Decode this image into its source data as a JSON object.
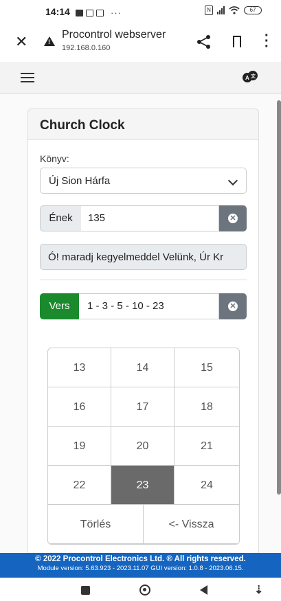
{
  "status_bar": {
    "time": "14:14",
    "dots": "···",
    "battery": "67",
    "nfc": "N"
  },
  "browser": {
    "title": "Procontrol webserver",
    "url": "192.168.0.160"
  },
  "card": {
    "title": "Church Clock"
  },
  "book": {
    "label": "Könyv:",
    "selected": "Új Sion Hárfa"
  },
  "song": {
    "addon_label": "Ének",
    "number": "135",
    "title": "Ó! maradj kegyelmeddel Velünk, Úr Kr"
  },
  "verse": {
    "addon_label": "Vers",
    "value": "1 - 3 - 5 - 10 - 23",
    "accent": "#1a8a2c"
  },
  "keypad": {
    "rows": [
      [
        "13",
        "14",
        "15"
      ],
      [
        "16",
        "17",
        "18"
      ],
      [
        "19",
        "20",
        "21"
      ],
      [
        "22",
        "23",
        "24"
      ]
    ],
    "selected": "23",
    "clear_label": "Törlés",
    "back_label": "<- Vissza"
  },
  "footer": {
    "copyright": "© 2022 Procontrol Electronics Ltd. ® All rights reserved.",
    "versions": "Module version: 5.63.923 - 2023.11.07    GUI version: 1.0.8 - 2023.06.15."
  },
  "colors": {
    "footer": "#1565c0",
    "verse_green": "#1a8a2c",
    "active_key": "#6a6a6a"
  }
}
